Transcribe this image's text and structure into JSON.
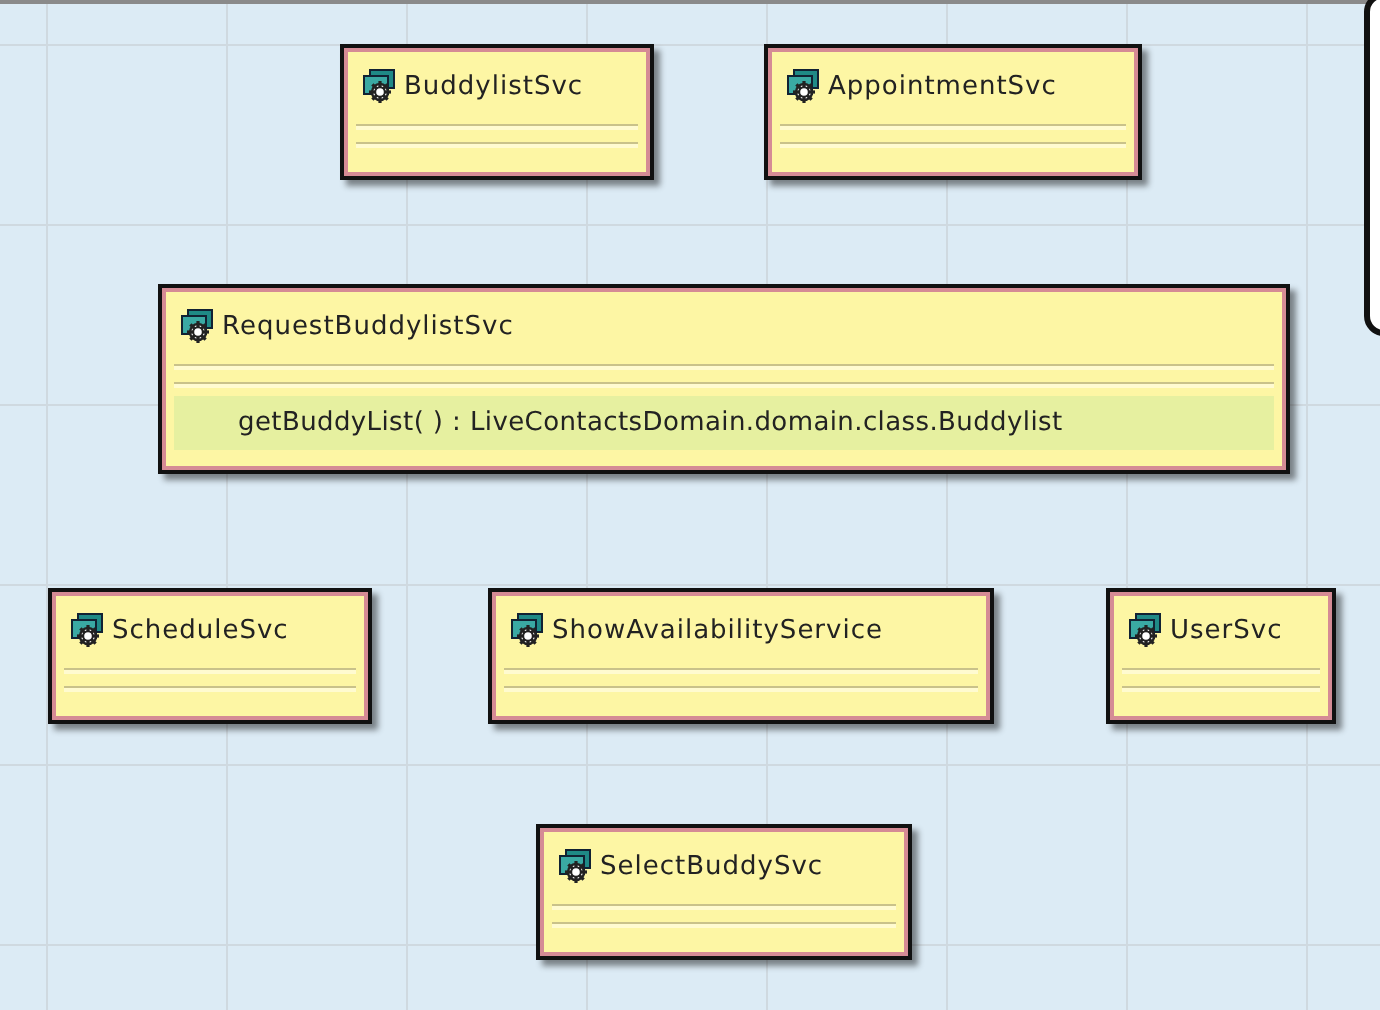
{
  "diagram": {
    "classes": [
      {
        "name": "BuddylistSvc"
      },
      {
        "name": "AppointmentSvc"
      },
      {
        "name": "RequestBuddylistSvc",
        "operations": [
          "getBuddyList( ) : LiveContactsDomain.domain.class.Buddylist"
        ]
      },
      {
        "name": "ScheduleSvc"
      },
      {
        "name": "ShowAvailabilityService"
      },
      {
        "name": "UserSvc"
      },
      {
        "name": "SelectBuddySvc"
      }
    ]
  }
}
